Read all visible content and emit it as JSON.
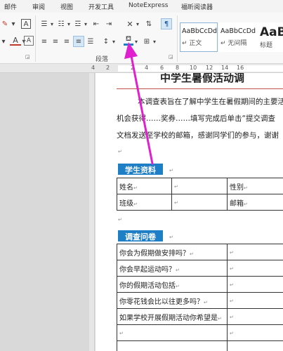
{
  "menu": {
    "items": [
      "邮件",
      "审阅",
      "视图",
      "开发工具",
      "NoteExpress",
      "福昕阅读器"
    ]
  },
  "ribbon": {
    "format_painter_icon": "✎",
    "border_letter": "A",
    "paragraph_group_label": "段落",
    "styles": [
      {
        "sample": "AaBbCcDd",
        "name": "↵ 正文"
      },
      {
        "sample": "AaBbCcDd",
        "name": "↵ 无间隔"
      },
      {
        "sample": "AaB",
        "name": "标题"
      }
    ]
  },
  "ruler": {
    "numbers": [
      "4",
      "2",
      "2",
      "4",
      "6",
      "8",
      "10",
      "12",
      "14",
      "16"
    ]
  },
  "document": {
    "title": "中学生暑假活动调",
    "intro_line1": "本调查表旨在了解中学生在暑假期间的主要活",
    "intro_line2": "机会获得……奖券……填写完成后单击“提交调查",
    "intro_line3": "文档发送至学校的邮箱，感谢同学们的参与，谢谢",
    "section1": "学生资料",
    "student_table": [
      [
        "姓名",
        "",
        "性别"
      ],
      [
        "班级",
        "",
        "邮箱"
      ]
    ],
    "section2": "调查问卷",
    "survey_questions": [
      "你会为假期做安排吗？",
      "你会早起运动吗？",
      "你的假期活动包括",
      "你零花钱会比以往更多吗？",
      "如果学校开展假期活动你希望是"
    ],
    "paragraph_mark": "↵"
  },
  "colors": {
    "section_header": "#1f7fc6",
    "title_rule": "#c0504d",
    "annotation_arrow": "#e020d0"
  }
}
